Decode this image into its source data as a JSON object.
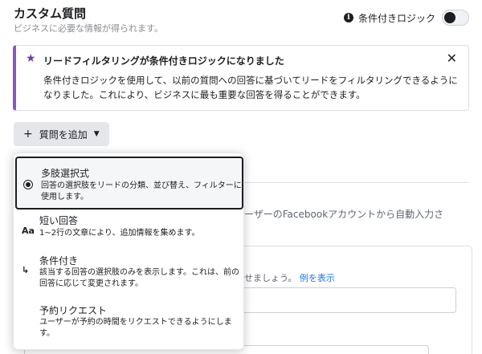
{
  "header": {
    "title": "カスタム質問",
    "subtitle": "ビジネスに必要な情報が得られます。",
    "conditional_label": "条件付きロジック",
    "conditional_enabled": false
  },
  "banner": {
    "title": "リードフィルタリングが条件付きロジックになりました",
    "body": "条件付きロジックを使用して、以前の質問への回答に基づいてリードをフィルタリングできるようになりました。これにより、ビジネスに最も重要な回答を得ることができます。",
    "close": "✕"
  },
  "add_question": {
    "plus": "+",
    "label": "質問を追加",
    "caret": "▼"
  },
  "background": {
    "autofill_text": "ーザーのFacebookアカウントから自動入力さ",
    "hint_text": "せましょう。",
    "hint_link": "例を表示"
  },
  "menu": {
    "items": [
      {
        "title": "多肢選択式",
        "desc": "回答の選択肢をリードの分類、並び替え、フィルターに使用します。",
        "icon": "radio-icon",
        "selected": true
      },
      {
        "title": "短い回答",
        "desc": "1~2行の文章により、追加情報を集めます。",
        "icon": "text-aa-icon",
        "icon_text": "Aa"
      },
      {
        "title": "条件付き",
        "desc": "該当する回答の選択肢のみを表示します。これは、前の回答に応じて変更されます。",
        "icon": "branch-icon",
        "icon_text": "↳"
      },
      {
        "title": "予約リクエスト",
        "desc": "ユーザーが予約の時間をリクエストできるようにします。",
        "icon": "clock-icon"
      }
    ]
  },
  "colors": {
    "accent_purple": "#8a56c2",
    "link_blue": "#1877f2",
    "button_gray": "#e4e6eb"
  }
}
